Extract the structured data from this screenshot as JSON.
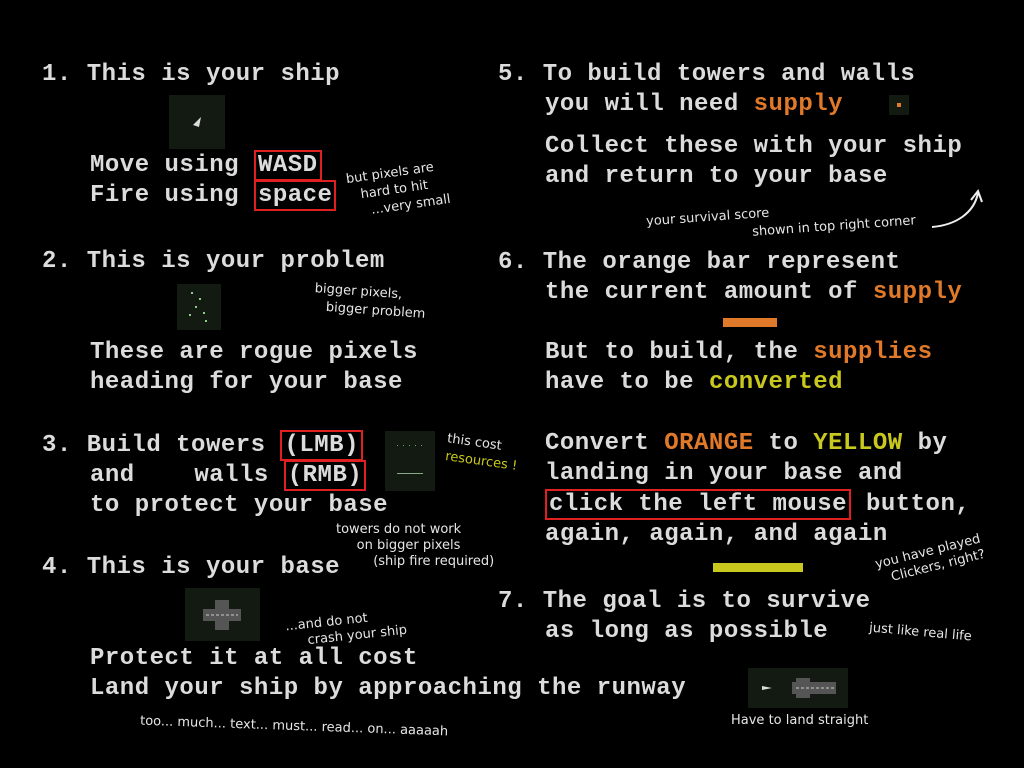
{
  "colors": {
    "background": "#000000",
    "text": "#dcdcdc",
    "orange": "#e07a2a",
    "yellow": "#c8c81e",
    "highlight_border": "#e02020"
  },
  "left": {
    "s1_num": "1.",
    "s1_title": "This is your ship",
    "s1_move_prefix": "Move using ",
    "s1_move_key": "WASD",
    "s1_fire_prefix": "Fire using ",
    "s1_fire_key": "space",
    "s2_num": "2.",
    "s2_title": "This is your problem",
    "s2_line1": "These are rogue pixels",
    "s2_line2": "heading for your base",
    "s3_num": "3.",
    "s3_line1_prefix": "Build towers ",
    "s3_line1_key": "(LMB)",
    "s3_line2_prefix": "and    walls ",
    "s3_line2_key": "(RMB)",
    "s3_line3": "to protect your base",
    "s4_num": "4.",
    "s4_title": "This is your base",
    "s4_line1": "Protect it at all cost",
    "s4_line2": "Land your ship by approaching the runway"
  },
  "right": {
    "s5_num": "5.",
    "s5_line1": "To build towers and walls",
    "s5_line2_prefix": "you will need ",
    "s5_line2_word": "supply",
    "s5_line3": "Collect these with your ship",
    "s5_line4": "and return to your base",
    "s6_num": "6.",
    "s6_line1": "The orange bar represent",
    "s6_line2_prefix": "the current amount of ",
    "s6_line2_word": "supply",
    "s6_line3_prefix": "But to build, the ",
    "s6_line3_word": "supplies",
    "s6_line4_prefix": "have to be ",
    "s6_line4_word": "converted",
    "s6_line5_a": "Convert ",
    "s6_line5_orange": "ORANGE",
    "s6_line5_b": " to ",
    "s6_line5_yellow": "YELLOW",
    "s6_line5_c": " by",
    "s6_line6": "landing in your base and",
    "s6_line7_key": "click the left mouse",
    "s6_line7_suffix": " button,",
    "s6_line8": "again, again, and again",
    "s7_num": "7.",
    "s7_line1": "The goal is to survive",
    "s7_line2": "as long as possible"
  },
  "notes": {
    "pixels_hard": "but pixels are\n   hard to hit\n     ...very small",
    "bigger_problem": "bigger pixels,\n   bigger problem",
    "cost": "this cost",
    "resources": "resources !",
    "towers_note": "towers do not work\n     on bigger pixels\n         (ship fire required)",
    "crash": "...and do not\n     crash your ship",
    "too_much": "too... much... text... must... read... on... aaaaah",
    "land_straight": "Have to land straight",
    "score_a": "your survival score",
    "score_b": "shown in top right corner",
    "clickers": "you have played\n   Clickers, right?",
    "real_life": "just like real life"
  }
}
